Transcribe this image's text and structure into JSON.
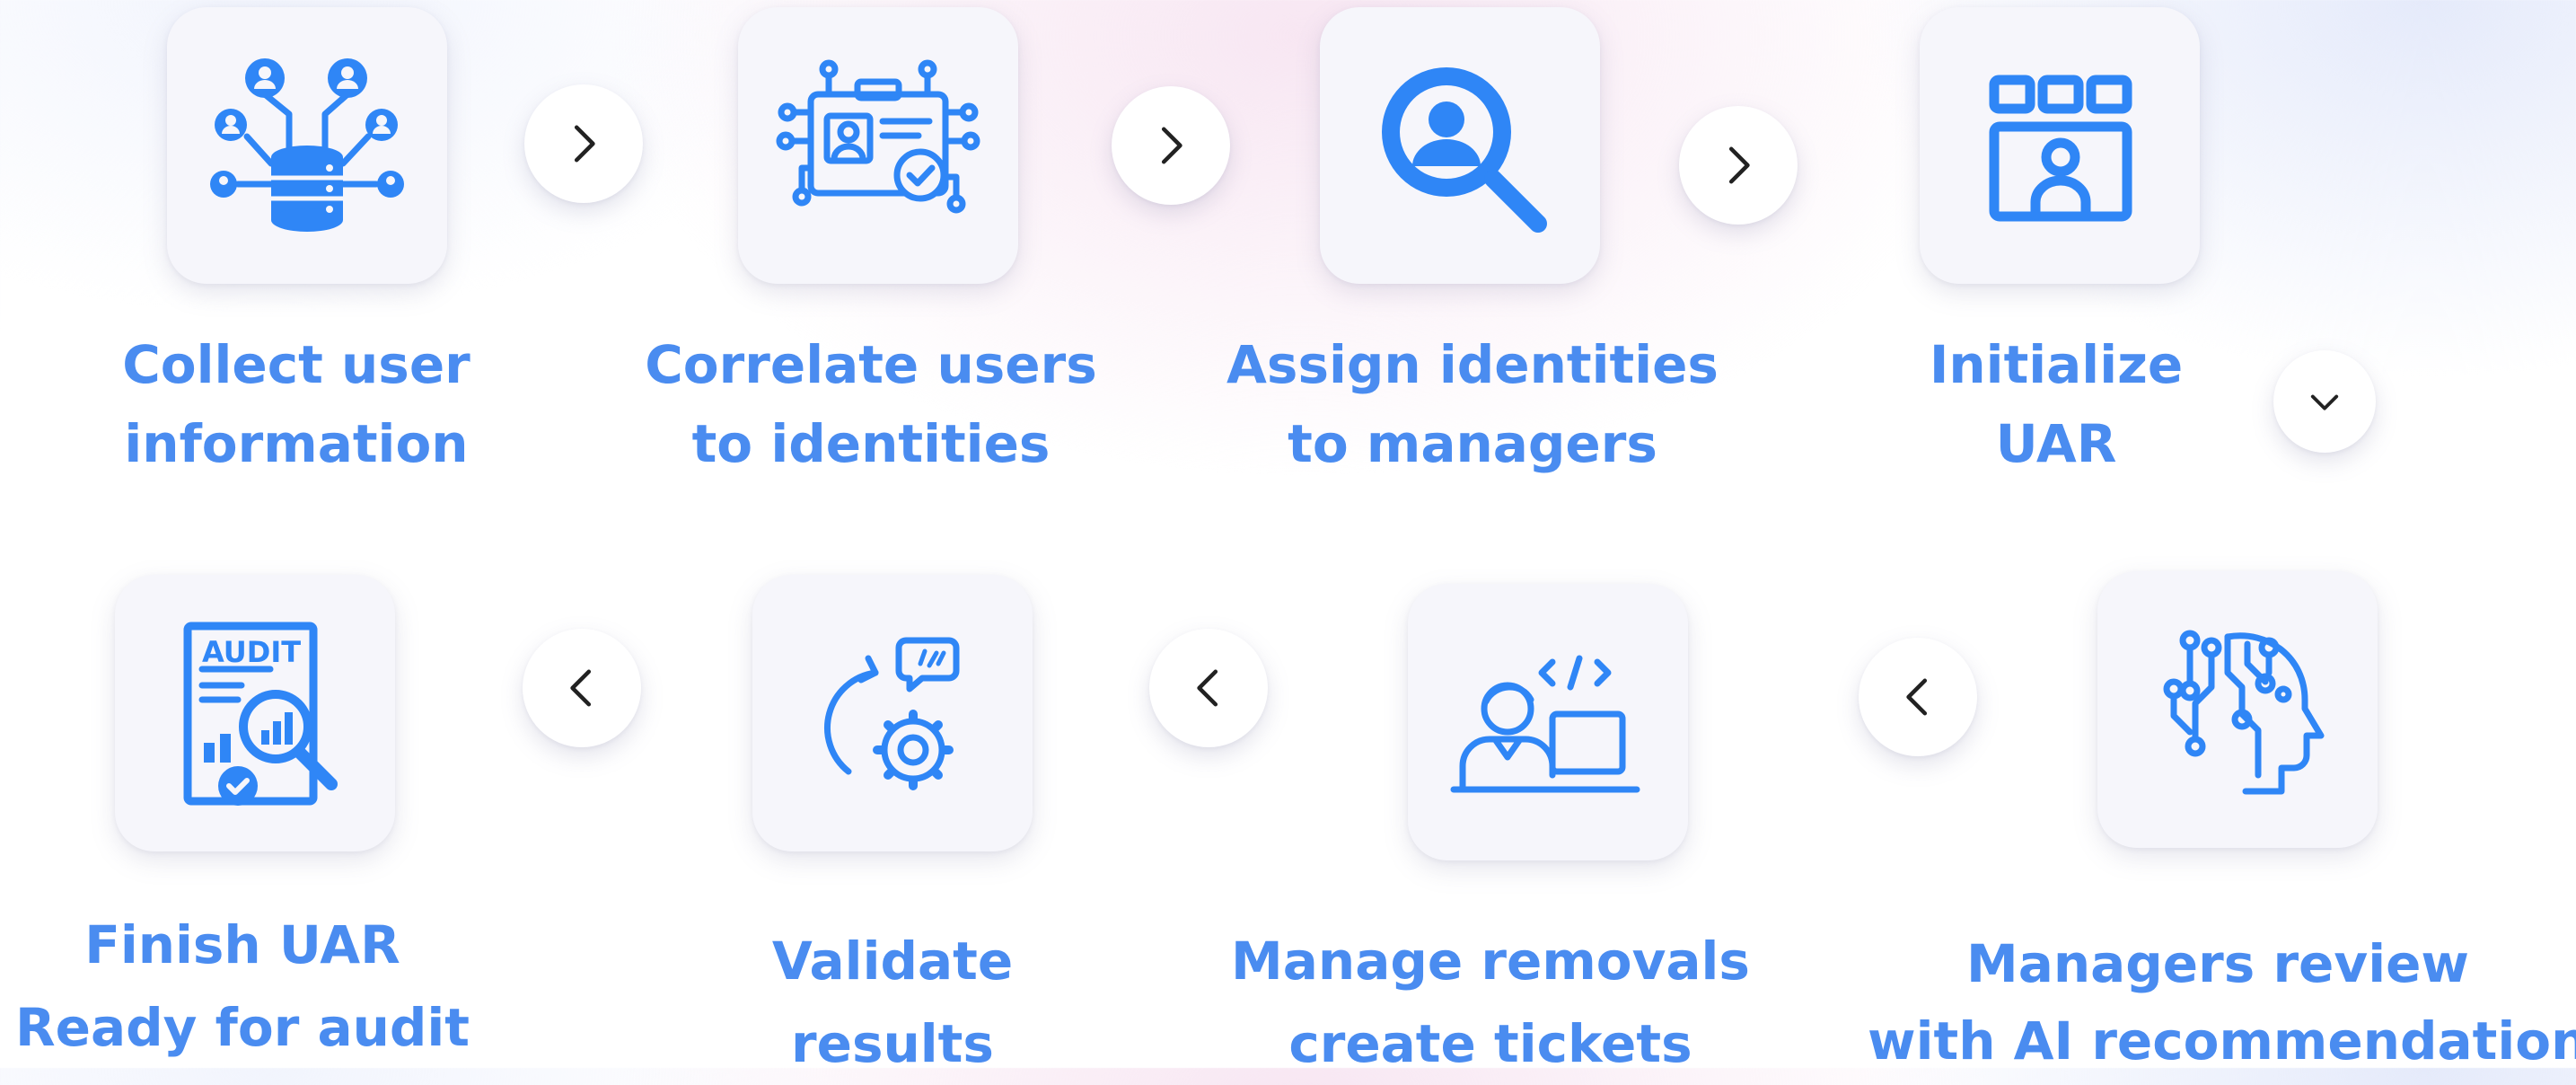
{
  "colors": {
    "accent": "#2f86f6",
    "label_text": "#4a8cf0",
    "tile_bg": "#f6f6fb"
  },
  "steps": [
    {
      "icon": "user-database-icon",
      "line1": "Collect user",
      "line2": "information"
    },
    {
      "icon": "identity-card-circuit-icon",
      "line1": "Correlate users",
      "line2": "to identities"
    },
    {
      "icon": "user-search-icon",
      "line1": "Assign identities",
      "line2": "to managers"
    },
    {
      "icon": "user-dashboard-icon",
      "line1": "Initialize",
      "line2": "UAR"
    },
    {
      "icon": "ai-head-circuit-icon",
      "line1": "Managers review",
      "line2": "with AI recommendations"
    },
    {
      "icon": "developer-laptop-icon",
      "line1": "Manage removals",
      "line2": "create tickets"
    },
    {
      "icon": "refresh-gear-chat-icon",
      "line1": "Validate",
      "line2": "results"
    },
    {
      "icon": "audit-report-icon",
      "line1": "Finish UAR",
      "line2": "Ready for audit",
      "badge": "AUDIT"
    }
  ],
  "arrows": [
    "chevron-right-icon",
    "chevron-right-icon",
    "chevron-right-icon",
    "chevron-down-icon",
    "chevron-left-icon",
    "chevron-left-icon",
    "chevron-left-icon"
  ]
}
